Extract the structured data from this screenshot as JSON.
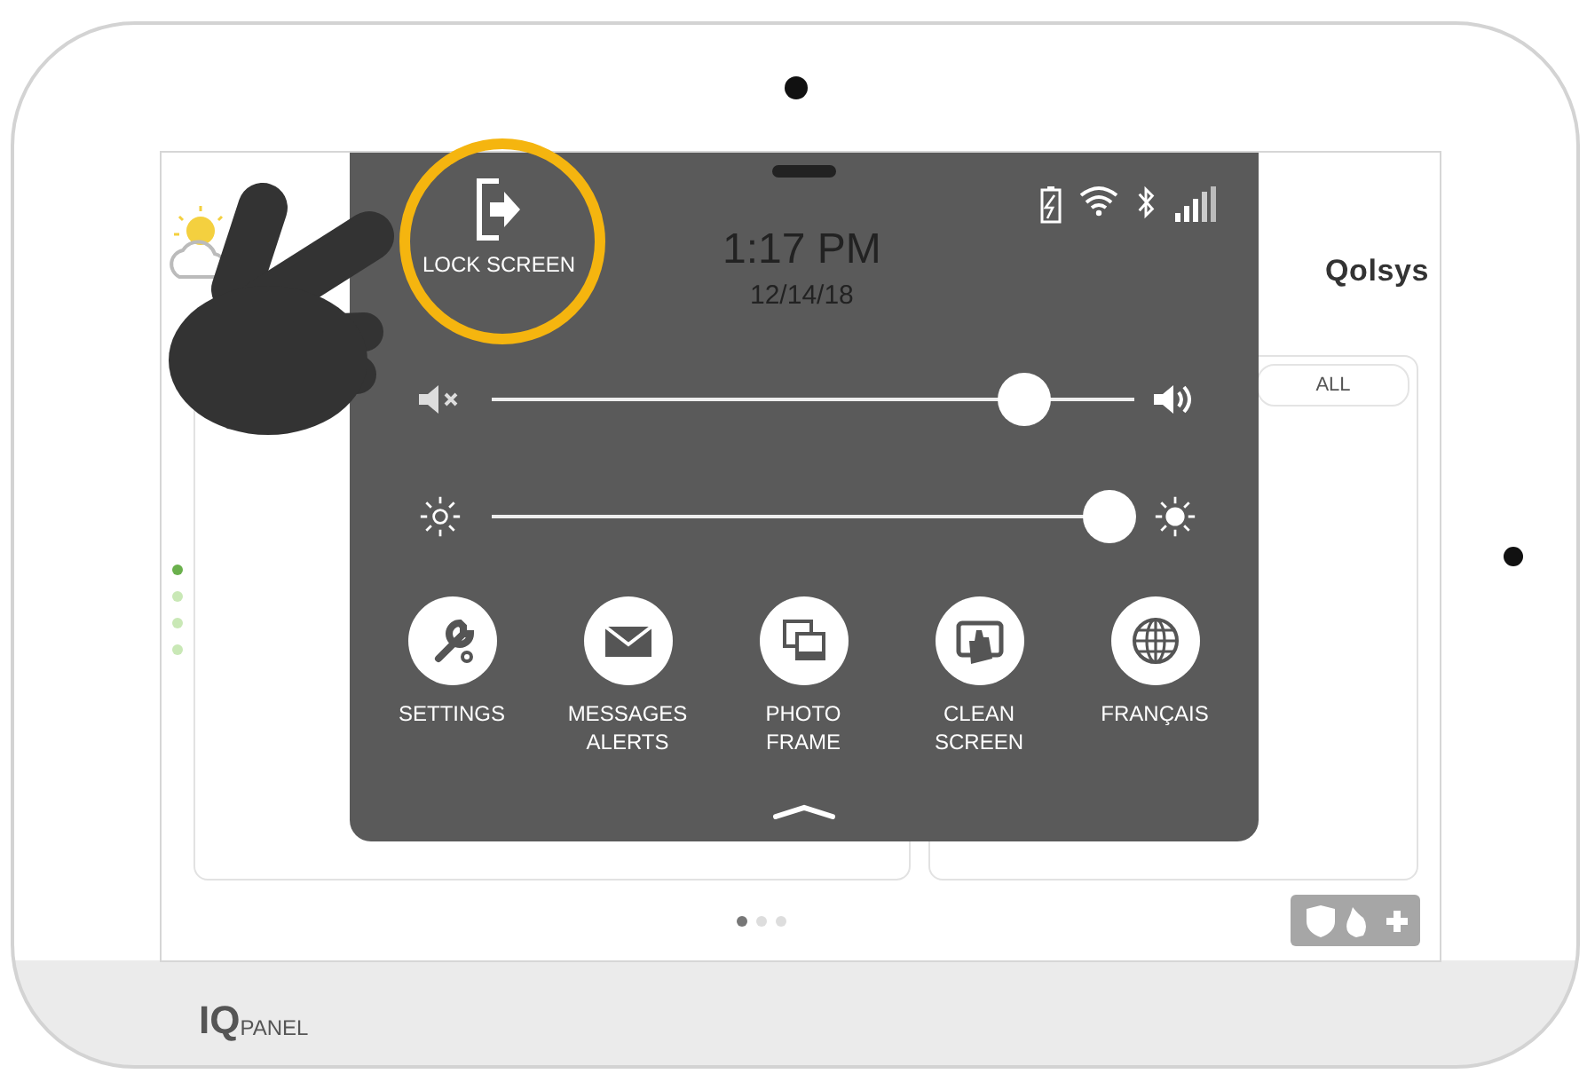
{
  "device": {
    "brand_mark": "IQ",
    "brand_name": "PANEL"
  },
  "home": {
    "logo": "Qolsys",
    "side_dots": [
      {
        "selected": true
      },
      {
        "selected": false
      },
      {
        "selected": false
      },
      {
        "selected": false
      }
    ],
    "tabs": [
      {
        "label": "ALL",
        "selected": false
      }
    ],
    "page_dots": [
      {
        "selected": true
      },
      {
        "selected": false
      },
      {
        "selected": false
      }
    ]
  },
  "drawer": {
    "lock_button": {
      "label": "LOCK SCREEN"
    },
    "time": "1:17 PM",
    "date": "12/14/18",
    "sliders": [
      {
        "kind": "volume",
        "level": 0.83
      },
      {
        "kind": "brightness",
        "level": 0.96
      }
    ],
    "actions": [
      {
        "kind": "settings",
        "label": "SETTINGS"
      },
      {
        "kind": "messages",
        "label": "MESSAGES ALERTS"
      },
      {
        "kind": "photo",
        "label": "PHOTO FRAME"
      },
      {
        "kind": "clean",
        "label": "CLEAN SCREEN"
      },
      {
        "kind": "language",
        "label": "FRANÇAIS"
      }
    ]
  }
}
